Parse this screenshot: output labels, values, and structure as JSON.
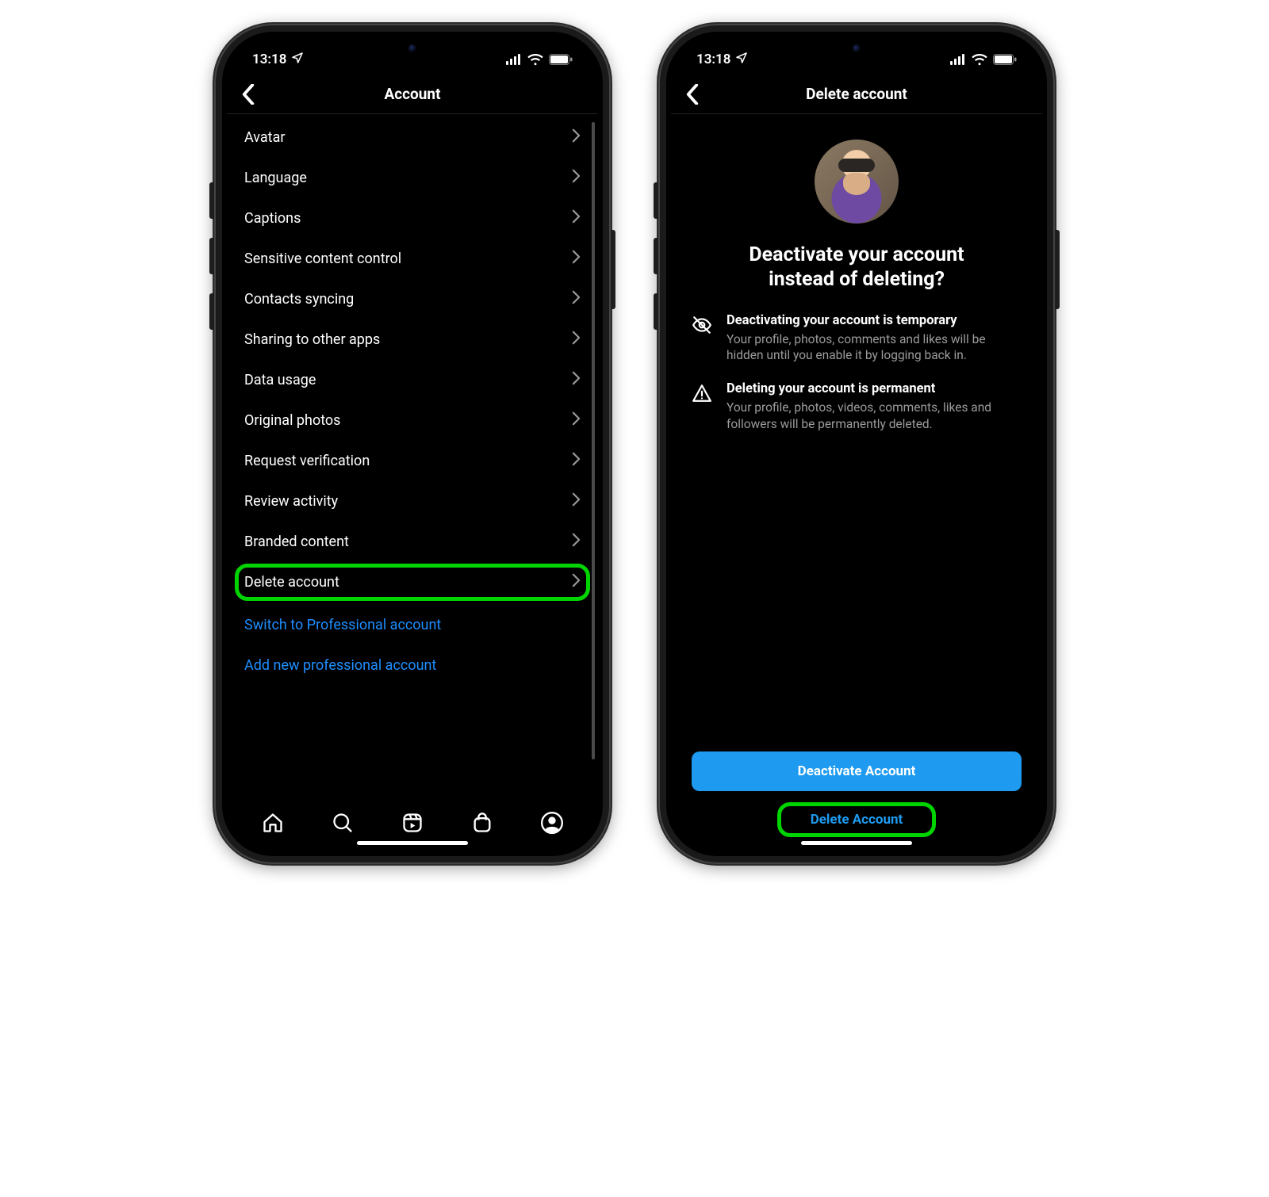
{
  "status": {
    "time": "13:18"
  },
  "left": {
    "header_title": "Account",
    "items": [
      {
        "label": "Avatar"
      },
      {
        "label": "Language"
      },
      {
        "label": "Captions"
      },
      {
        "label": "Sensitive content control"
      },
      {
        "label": "Contacts syncing"
      },
      {
        "label": "Sharing to other apps"
      },
      {
        "label": "Data usage"
      },
      {
        "label": "Original photos"
      },
      {
        "label": "Request verification"
      },
      {
        "label": "Review activity"
      },
      {
        "label": "Branded content"
      },
      {
        "label": "Delete account"
      }
    ],
    "accent_items": [
      {
        "label": "Switch to Professional account"
      },
      {
        "label": "Add new professional account"
      }
    ]
  },
  "right": {
    "header_title": "Delete account",
    "heading_line1": "Deactivate your account",
    "heading_line2": "instead of deleting?",
    "info1_title": "Deactivating your account is temporary",
    "info1_body": "Your profile, photos, comments and likes will be hidden until you enable it by logging back in.",
    "info2_title": "Deleting your account is permanent",
    "info2_body": "Your profile, photos, videos, comments, likes and followers will be permanently deleted.",
    "btn_deactivate": "Deactivate Account",
    "btn_delete": "Delete Account"
  }
}
